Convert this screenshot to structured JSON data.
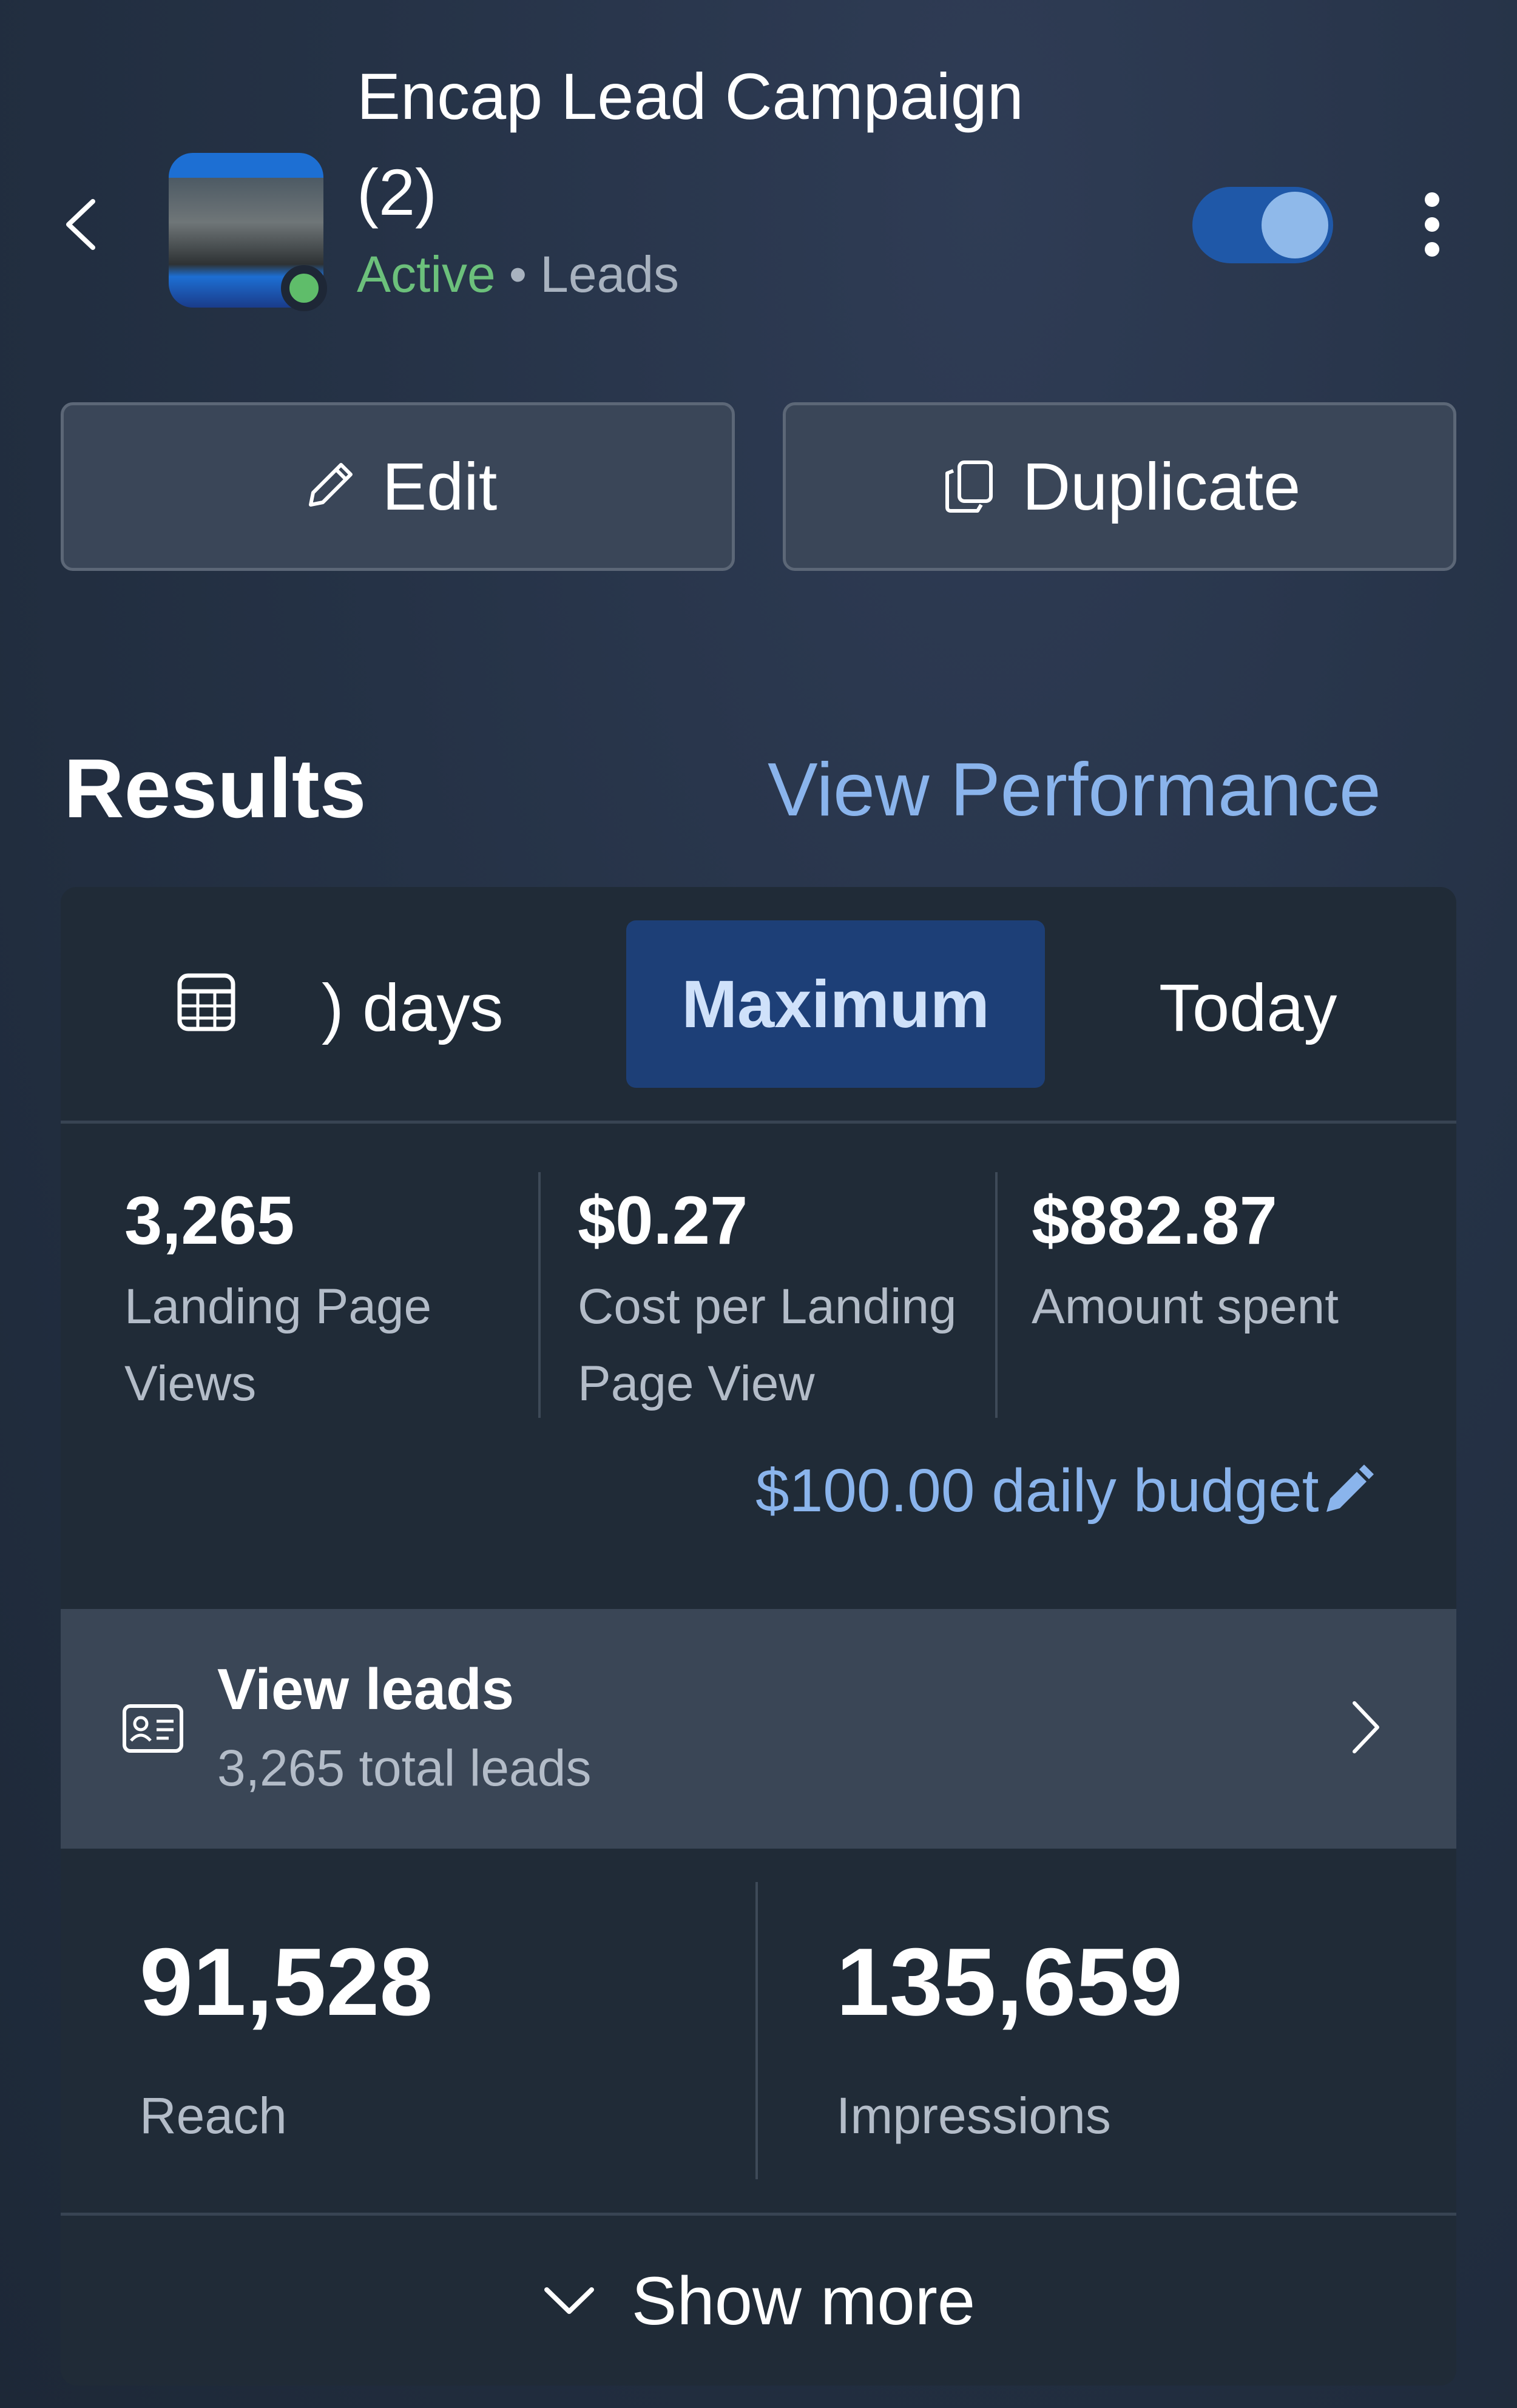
{
  "header": {
    "title": "Encap Lead Campaign (2)",
    "status": "Active",
    "separator": "•",
    "objective": "Leads",
    "toggle_on": true
  },
  "actions": {
    "edit_label": "Edit",
    "duplicate_label": "Duplicate"
  },
  "results": {
    "title": "Results",
    "view_performance": "View Performance"
  },
  "date_range": {
    "options": [
      ") days",
      "Maximum",
      "Today"
    ],
    "selected": "Maximum"
  },
  "metrics": [
    {
      "value": "3,265",
      "label": "Landing Page Views"
    },
    {
      "value": "$0.27",
      "label": "Cost per Landing Page View"
    },
    {
      "value": "$882.87",
      "label": "Amount spent"
    }
  ],
  "budget": "$100.00 daily budget",
  "leads": {
    "title": "View leads",
    "subtitle": "3,265 total leads"
  },
  "totals": [
    {
      "value": "91,528",
      "label": "Reach"
    },
    {
      "value": "135,659",
      "label": "Impressions"
    }
  ],
  "show_more": "Show more",
  "colors": {
    "accent_link": "#8ab4ec",
    "active_green": "#6cc07b",
    "selected_segment": "#1d3f77",
    "card_bg": "#202b37"
  },
  "icons": [
    "back-chevron-icon",
    "more-vertical-icon",
    "pencil-icon",
    "duplicate-icon",
    "calendar-icon",
    "pencil-filled-icon",
    "lead-card-icon",
    "chevron-right-icon",
    "chevron-down-icon"
  ]
}
